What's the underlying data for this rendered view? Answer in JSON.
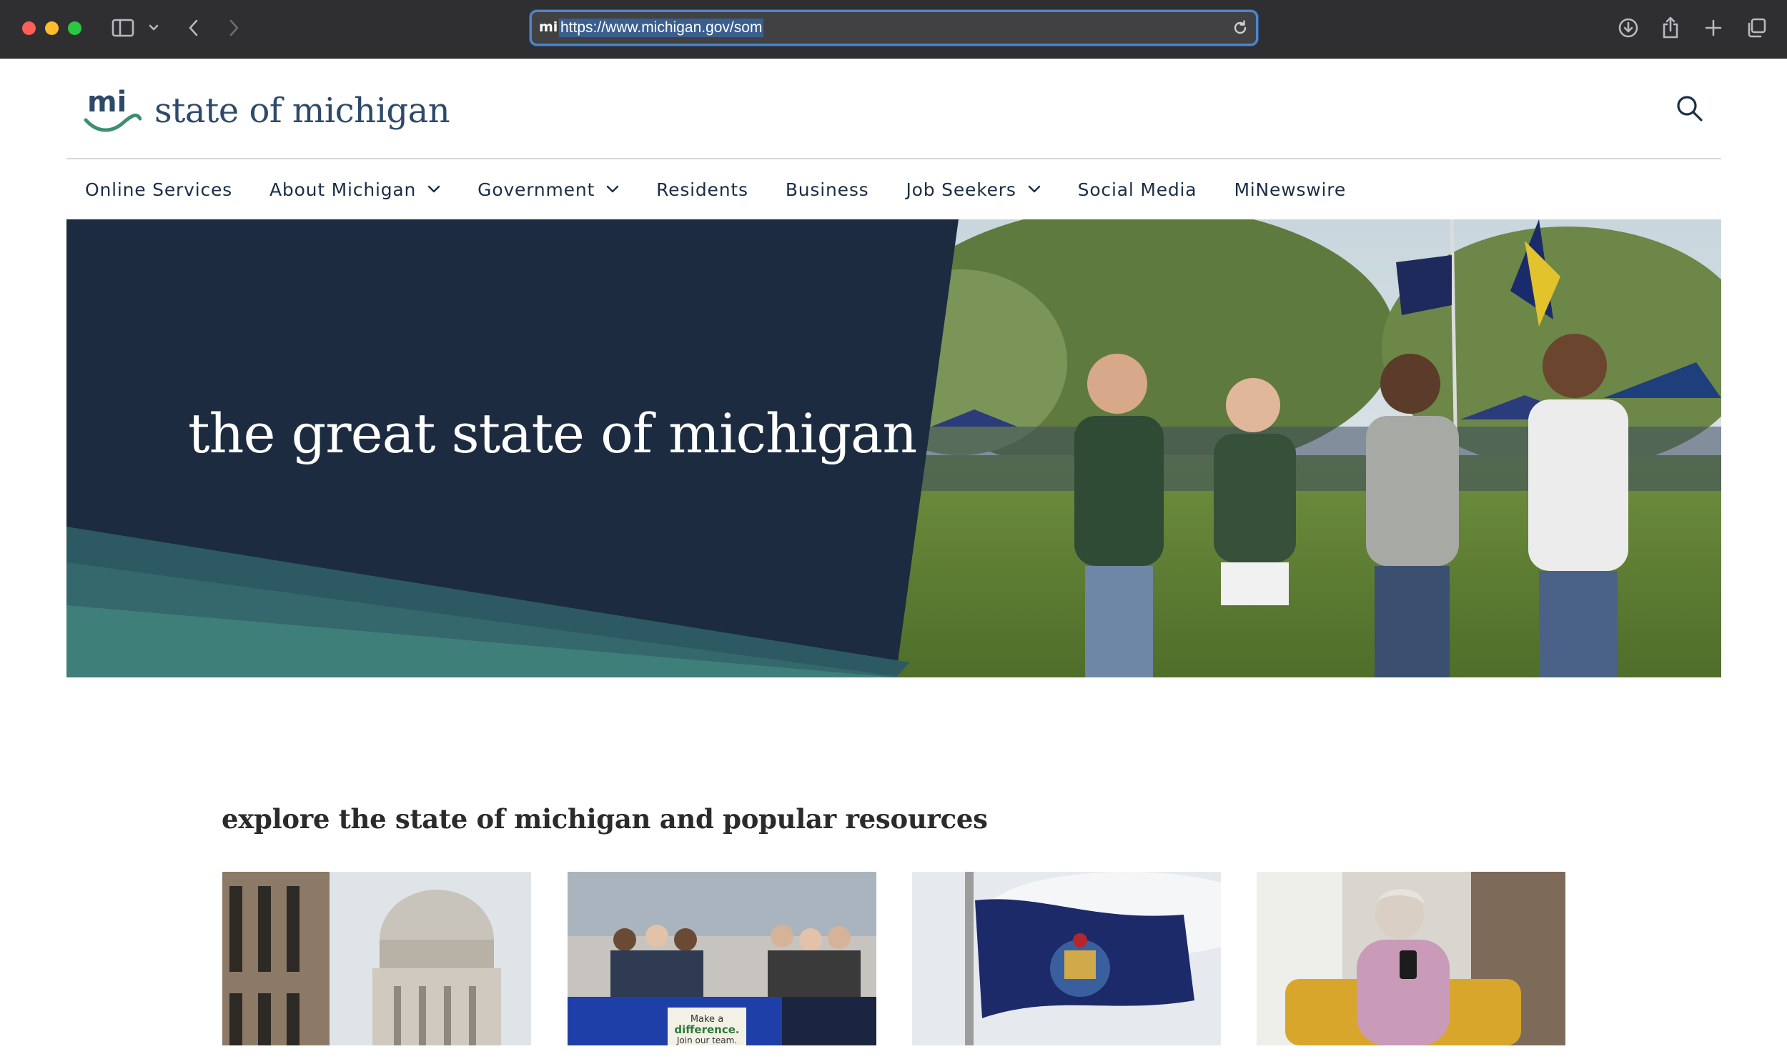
{
  "browser": {
    "url": "https://www.michigan.gov/som",
    "favicon_text": "mi"
  },
  "site": {
    "logo_text": "state of michigan",
    "logo_mark_text": "mi"
  },
  "nav": {
    "items": [
      {
        "label": "Online Services",
        "has_dropdown": false
      },
      {
        "label": "About Michigan",
        "has_dropdown": true
      },
      {
        "label": "Government",
        "has_dropdown": true
      },
      {
        "label": "Residents",
        "has_dropdown": false
      },
      {
        "label": "Business",
        "has_dropdown": false
      },
      {
        "label": "Job Seekers",
        "has_dropdown": true
      },
      {
        "label": "Social Media",
        "has_dropdown": false
      },
      {
        "label": "MiNewswire",
        "has_dropdown": false
      }
    ]
  },
  "hero": {
    "title": "the great state of michigan"
  },
  "explore": {
    "title": "explore the state of michigan and popular resources",
    "card2_sign": "Make a difference. Join our team."
  },
  "colors": {
    "hero_navy": "#1c2b40",
    "hero_teal": "#3f7f79",
    "brand_navy": "#2e4a6b",
    "brand_green": "#3f8f6e"
  }
}
